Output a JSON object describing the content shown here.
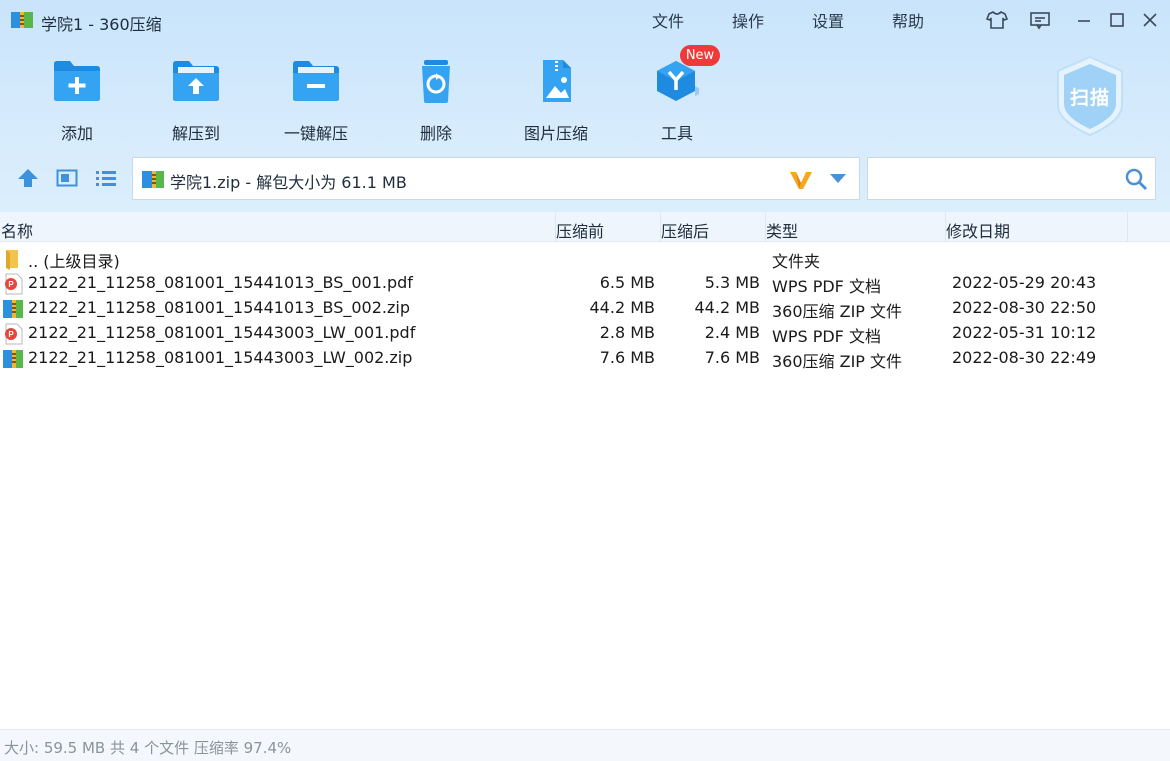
{
  "window": {
    "title": "学院1 - 360压缩",
    "menu": [
      "文件",
      "操作",
      "设置",
      "帮助"
    ]
  },
  "toolbar": {
    "items": [
      {
        "label": "添加",
        "icon": "folder-add-icon"
      },
      {
        "label": "解压到",
        "icon": "folder-extract-icon"
      },
      {
        "label": "一键解压",
        "icon": "folder-oneclick-icon"
      },
      {
        "label": "删除",
        "icon": "recycle-bin-icon"
      },
      {
        "label": "图片压缩",
        "icon": "image-compress-icon"
      },
      {
        "label": "工具",
        "icon": "tools-icon"
      }
    ],
    "new_badge": "New",
    "scan_label": "扫描"
  },
  "address": {
    "text": "学院1.zip - 解包大小为 61.1 MB",
    "search_placeholder": ""
  },
  "columns": {
    "name": "名称",
    "before": "压缩前",
    "after": "压缩后",
    "type": "类型",
    "date": "修改日期"
  },
  "rows": [
    {
      "name": ".. (上级目录)",
      "before": "",
      "after": "",
      "type": "文件夹",
      "date": "",
      "kind": "folder"
    },
    {
      "name": "2122_21_11258_081001_15441013_BS_001.pdf",
      "before": "6.5 MB",
      "after": "5.3 MB",
      "type": "WPS PDF 文档",
      "date": "2022-05-29 20:43",
      "kind": "pdf"
    },
    {
      "name": "2122_21_11258_081001_15441013_BS_002.zip",
      "before": "44.2 MB",
      "after": "44.2 MB",
      "type": "360压缩 ZIP 文件",
      "date": "2022-08-30 22:50",
      "kind": "zip"
    },
    {
      "name": "2122_21_11258_081001_15443003_LW_001.pdf",
      "before": "2.8 MB",
      "after": "2.4 MB",
      "type": "WPS PDF 文档",
      "date": "2022-05-31 10:12",
      "kind": "pdf"
    },
    {
      "name": "2122_21_11258_081001_15443003_LW_002.zip",
      "before": "7.6 MB",
      "after": "7.6 MB",
      "type": "360压缩 ZIP 文件",
      "date": "2022-08-30 22:49",
      "kind": "zip"
    }
  ],
  "status": {
    "text": "大小: 59.5 MB 共 4 个文件 压缩率 97.4%"
  },
  "colors": {
    "accent": "#2a8fe6",
    "header_bg": "#d3e9fb",
    "new_badge": "#f03a3a"
  }
}
